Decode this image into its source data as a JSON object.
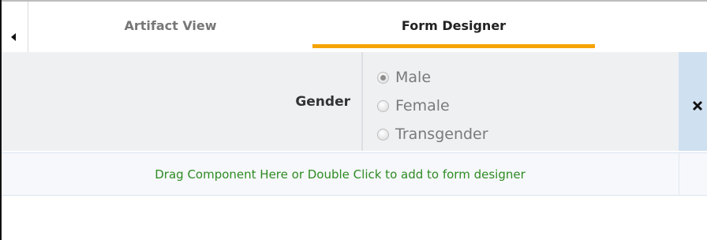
{
  "tabs": [
    {
      "label": "Artifact View",
      "active": false
    },
    {
      "label": "Form Designer",
      "active": true
    }
  ],
  "colors": {
    "active_tab_underline": "#f5a300",
    "drop_hint_text": "#2e8b22",
    "delete_cell_bg": "#cfe0f1"
  },
  "field": {
    "label": "Gender",
    "options": [
      {
        "label": "Male",
        "selected": true
      },
      {
        "label": "Female",
        "selected": false
      },
      {
        "label": "Transgender",
        "selected": false
      }
    ]
  },
  "drop_zone": {
    "text": "Drag Component Here or Double Click to add to form designer"
  },
  "icons": {
    "collapse": "triangle-left-icon",
    "delete": "close-x-icon"
  }
}
